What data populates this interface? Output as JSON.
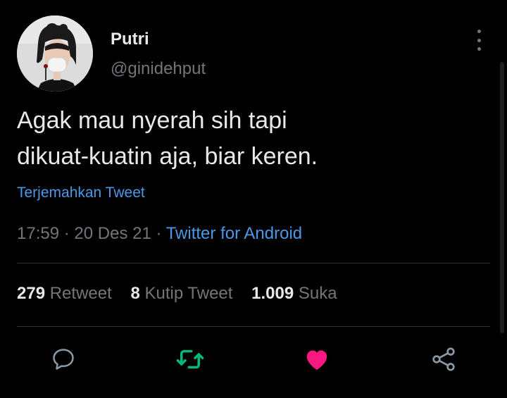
{
  "user": {
    "display_name": "Putri",
    "handle": "@ginidehput"
  },
  "tweet": {
    "text_lines": [
      "Agak mau nyerah sih tapi",
      "dikuat-kuatin aja, biar keren."
    ],
    "translate_label": "Terjemahkan Tweet",
    "time": "17:59",
    "date": "20 Des 21",
    "separator": "·",
    "source": "Twitter for Android"
  },
  "stats": {
    "retweets": {
      "count": "279",
      "label": "Retweet"
    },
    "quotes": {
      "count": "8",
      "label": "Kutip Tweet"
    },
    "likes": {
      "count": "1.009",
      "label": "Suka"
    }
  },
  "actions": {
    "reply_icon": "reply-icon",
    "retweet_icon": "retweet-icon",
    "like_icon": "heart-filled-icon",
    "share_icon": "share-icon"
  },
  "colors": {
    "background": "#000000",
    "text": "#e7e9ea",
    "muted": "#71767b",
    "link": "#4a99e9",
    "retweet_active": "#00ba7c",
    "like_active": "#f91880"
  }
}
